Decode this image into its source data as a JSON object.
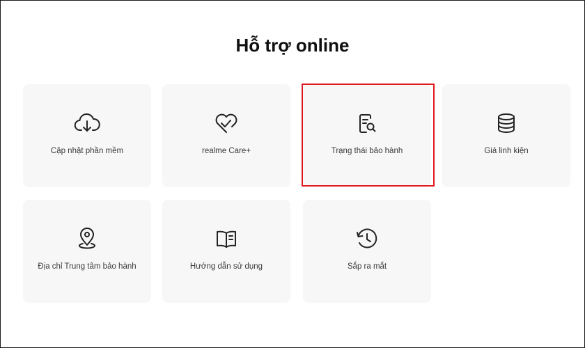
{
  "page": {
    "title": "Hỗ trợ online"
  },
  "cards": [
    {
      "label": "Cập nhật phần mềm",
      "icon": "cloud-download-icon"
    },
    {
      "label": "realme Care+",
      "icon": "heart-check-icon"
    },
    {
      "label": "Trạng thái bảo hành",
      "icon": "document-search-icon"
    },
    {
      "label": "Giá linh kiện",
      "icon": "database-icon"
    },
    {
      "label": "Địa chỉ Trung tâm bảo hành",
      "icon": "location-pin-icon"
    },
    {
      "label": "Hướng dẫn sử dụng",
      "icon": "open-book-icon"
    },
    {
      "label": "Sắp ra mắt",
      "icon": "history-clock-icon"
    }
  ],
  "colors": {
    "highlight": "#e0191e",
    "card_bg": "#f7f7f7",
    "icon": "#222222"
  }
}
